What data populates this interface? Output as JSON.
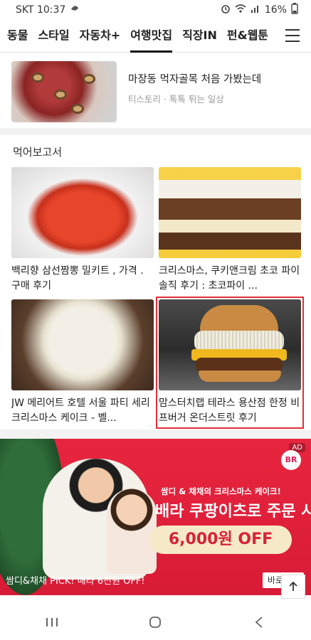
{
  "status": {
    "carrier_time": "SKT 10:37",
    "battery": "16%"
  },
  "tabs": [
    {
      "label": "동물"
    },
    {
      "label": "스타일"
    },
    {
      "label": "자동차+"
    },
    {
      "label": "여행맛집",
      "active": true
    },
    {
      "label": "직장IN"
    },
    {
      "label": "펀&웹툰"
    }
  ],
  "previous_item": {
    "title": "마장동 먹자골목 처음 가봤는데",
    "meta": "티스토리 · 톡톡 튀는 일상"
  },
  "section": {
    "title": "먹어보고서"
  },
  "cards": [
    {
      "title": "백리향 삼선짬뽕 밀키트 , 가격 . 구매 후기"
    },
    {
      "title": "크리스마스, 쿠키앤크림 초코 파이 솔직 후기 : 초코파이 ..."
    },
    {
      "title": "JW 메리어트 호텔 서울 파티 세리 크리스마스 케이크 - 벨..."
    },
    {
      "title": "맘스터치랩 테라스 용산점 한정 비프버거 온더스트릿 후기"
    }
  ],
  "ad": {
    "badge": "AD",
    "logo": "BR",
    "subhead": "쌈디 & 채채의 크리스마스 케이크!",
    "headline": "배라 쿠팡이츠로 주문 시",
    "offer": "6,000원 OFF",
    "caption": "쌈디&채채 PICK! 배라 6천원 OFF!",
    "button": "바로가기"
  },
  "colors": {
    "highlight": "#e02e3a",
    "ad_bg": "#e8253f"
  }
}
